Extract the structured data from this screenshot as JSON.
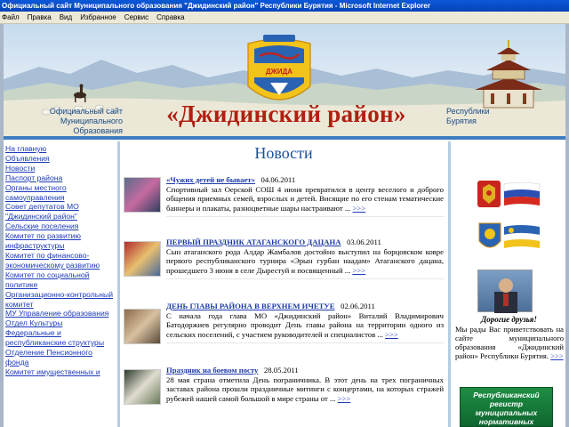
{
  "window": {
    "title": "Официальный сайт Муниципального образования \"Джидинский район\" Республики Бурятия - Microsoft Internet Explorer"
  },
  "menu": [
    "Файл",
    "Правка",
    "Вид",
    "Избранное",
    "Сервис",
    "Справка"
  ],
  "banner": {
    "left_text_1": "Официальный сайт",
    "left_text_2": "Муниципального Образования",
    "main_title": "«Джидинский район»",
    "right_text_1": "Республики",
    "right_text_2": "Бурятия",
    "emblem_text": "ДЖИДА"
  },
  "nav": [
    "На главную",
    "Объявления",
    "Новости",
    "Паспорт района",
    "Органы местного",
    "самоуправления",
    "Совет депутатов МО",
    "\"Джидинский район\"",
    "Сельские поселения",
    "Комитет по развитию",
    "инфраструктуры",
    "Комитет по финансово-",
    "экономическому развитию",
    "Комитет по социальной",
    "политике",
    "Организационно-контрольный",
    "комитет",
    "МУ Управление образования",
    "Отдел Культуры",
    "Федеральные и",
    "республиканские структуры",
    "Отделение Пенсионного",
    "фонда",
    "Комитет имущественных и"
  ],
  "main": {
    "heading": "Новости",
    "more_label": ">>>",
    "news": [
      {
        "headline": "«Чужих детей не бывает»",
        "date": "04.06.2011",
        "text": "Спортивный зал Оерской СОШ 4 июня превратился в центр веселого и доброго общения приемных семей, взрослых и детей. Висящие по его стенам тематические баннеры и плакаты, разноцветные шары настраивают ..."
      },
      {
        "headline": "ПЕРВЫЙ ПРАЗДНИК АТАГАНСКОГО ДАЦАНА",
        "date": "03.06.2011",
        "text": "Сын атаганского рода Алдар Жамбалов достойно выступил на борцовском ковре первого республиканского турнира «Эрын гурбан наадам» Атаганского дацана, прошедшего 3 июня в селе Дырестуй и посвященный ..."
      },
      {
        "headline": "ДЕНЬ ГЛАВЫ РАЙОНА В ВЕРХНЕМ ИЧЕТУЕ",
        "date": "02.06.2011",
        "text": "С начала года глава МО «Джидинский район» Виталий Владимирович Батодоржиев регулярно проводит День главы района на территории одного из сельских поселений, с участием руководителей и специалистов ..."
      },
      {
        "headline": "Праздник на боевом посту",
        "date": "28.05.2011",
        "text": "28 мая страна отметила День пограничника. В этот день на трех пограничных заставах района прошли праздничные митинги с концертами, на которых стражей рубежей нашей самой большой в мире страны от ..."
      }
    ]
  },
  "right": {
    "greeting_title": "Дорогие друзья!",
    "greeting_text": "Мы рады Вас приветствовать на сайте муниципального образования «Джидинский район» Республики Бурятия.",
    "greeting_more": ">>>",
    "registry_text": "Республиканский регистр муниципальных нормативных правовых актов"
  },
  "colors": {
    "accent_title": "#b01f10",
    "link": "#1d3bbb",
    "heading": "#1b4f9c"
  }
}
